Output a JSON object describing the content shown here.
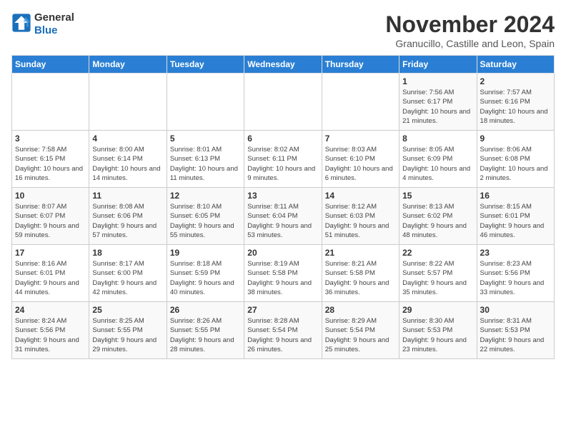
{
  "logo": {
    "general": "General",
    "blue": "Blue"
  },
  "title": "November 2024",
  "location": "Granucillo, Castille and Leon, Spain",
  "days_header": [
    "Sunday",
    "Monday",
    "Tuesday",
    "Wednesday",
    "Thursday",
    "Friday",
    "Saturday"
  ],
  "weeks": [
    [
      {
        "day": "",
        "sunrise": "",
        "sunset": "",
        "daylight": ""
      },
      {
        "day": "",
        "sunrise": "",
        "sunset": "",
        "daylight": ""
      },
      {
        "day": "",
        "sunrise": "",
        "sunset": "",
        "daylight": ""
      },
      {
        "day": "",
        "sunrise": "",
        "sunset": "",
        "daylight": ""
      },
      {
        "day": "",
        "sunrise": "",
        "sunset": "",
        "daylight": ""
      },
      {
        "day": "1",
        "sunrise": "Sunrise: 7:56 AM",
        "sunset": "Sunset: 6:17 PM",
        "daylight": "Daylight: 10 hours and 21 minutes."
      },
      {
        "day": "2",
        "sunrise": "Sunrise: 7:57 AM",
        "sunset": "Sunset: 6:16 PM",
        "daylight": "Daylight: 10 hours and 18 minutes."
      }
    ],
    [
      {
        "day": "3",
        "sunrise": "Sunrise: 7:58 AM",
        "sunset": "Sunset: 6:15 PM",
        "daylight": "Daylight: 10 hours and 16 minutes."
      },
      {
        "day": "4",
        "sunrise": "Sunrise: 8:00 AM",
        "sunset": "Sunset: 6:14 PM",
        "daylight": "Daylight: 10 hours and 14 minutes."
      },
      {
        "day": "5",
        "sunrise": "Sunrise: 8:01 AM",
        "sunset": "Sunset: 6:13 PM",
        "daylight": "Daylight: 10 hours and 11 minutes."
      },
      {
        "day": "6",
        "sunrise": "Sunrise: 8:02 AM",
        "sunset": "Sunset: 6:11 PM",
        "daylight": "Daylight: 10 hours and 9 minutes."
      },
      {
        "day": "7",
        "sunrise": "Sunrise: 8:03 AM",
        "sunset": "Sunset: 6:10 PM",
        "daylight": "Daylight: 10 hours and 6 minutes."
      },
      {
        "day": "8",
        "sunrise": "Sunrise: 8:05 AM",
        "sunset": "Sunset: 6:09 PM",
        "daylight": "Daylight: 10 hours and 4 minutes."
      },
      {
        "day": "9",
        "sunrise": "Sunrise: 8:06 AM",
        "sunset": "Sunset: 6:08 PM",
        "daylight": "Daylight: 10 hours and 2 minutes."
      }
    ],
    [
      {
        "day": "10",
        "sunrise": "Sunrise: 8:07 AM",
        "sunset": "Sunset: 6:07 PM",
        "daylight": "Daylight: 9 hours and 59 minutes."
      },
      {
        "day": "11",
        "sunrise": "Sunrise: 8:08 AM",
        "sunset": "Sunset: 6:06 PM",
        "daylight": "Daylight: 9 hours and 57 minutes."
      },
      {
        "day": "12",
        "sunrise": "Sunrise: 8:10 AM",
        "sunset": "Sunset: 6:05 PM",
        "daylight": "Daylight: 9 hours and 55 minutes."
      },
      {
        "day": "13",
        "sunrise": "Sunrise: 8:11 AM",
        "sunset": "Sunset: 6:04 PM",
        "daylight": "Daylight: 9 hours and 53 minutes."
      },
      {
        "day": "14",
        "sunrise": "Sunrise: 8:12 AM",
        "sunset": "Sunset: 6:03 PM",
        "daylight": "Daylight: 9 hours and 51 minutes."
      },
      {
        "day": "15",
        "sunrise": "Sunrise: 8:13 AM",
        "sunset": "Sunset: 6:02 PM",
        "daylight": "Daylight: 9 hours and 48 minutes."
      },
      {
        "day": "16",
        "sunrise": "Sunrise: 8:15 AM",
        "sunset": "Sunset: 6:01 PM",
        "daylight": "Daylight: 9 hours and 46 minutes."
      }
    ],
    [
      {
        "day": "17",
        "sunrise": "Sunrise: 8:16 AM",
        "sunset": "Sunset: 6:01 PM",
        "daylight": "Daylight: 9 hours and 44 minutes."
      },
      {
        "day": "18",
        "sunrise": "Sunrise: 8:17 AM",
        "sunset": "Sunset: 6:00 PM",
        "daylight": "Daylight: 9 hours and 42 minutes."
      },
      {
        "day": "19",
        "sunrise": "Sunrise: 8:18 AM",
        "sunset": "Sunset: 5:59 PM",
        "daylight": "Daylight: 9 hours and 40 minutes."
      },
      {
        "day": "20",
        "sunrise": "Sunrise: 8:19 AM",
        "sunset": "Sunset: 5:58 PM",
        "daylight": "Daylight: 9 hours and 38 minutes."
      },
      {
        "day": "21",
        "sunrise": "Sunrise: 8:21 AM",
        "sunset": "Sunset: 5:58 PM",
        "daylight": "Daylight: 9 hours and 36 minutes."
      },
      {
        "day": "22",
        "sunrise": "Sunrise: 8:22 AM",
        "sunset": "Sunset: 5:57 PM",
        "daylight": "Daylight: 9 hours and 35 minutes."
      },
      {
        "day": "23",
        "sunrise": "Sunrise: 8:23 AM",
        "sunset": "Sunset: 5:56 PM",
        "daylight": "Daylight: 9 hours and 33 minutes."
      }
    ],
    [
      {
        "day": "24",
        "sunrise": "Sunrise: 8:24 AM",
        "sunset": "Sunset: 5:56 PM",
        "daylight": "Daylight: 9 hours and 31 minutes."
      },
      {
        "day": "25",
        "sunrise": "Sunrise: 8:25 AM",
        "sunset": "Sunset: 5:55 PM",
        "daylight": "Daylight: 9 hours and 29 minutes."
      },
      {
        "day": "26",
        "sunrise": "Sunrise: 8:26 AM",
        "sunset": "Sunset: 5:55 PM",
        "daylight": "Daylight: 9 hours and 28 minutes."
      },
      {
        "day": "27",
        "sunrise": "Sunrise: 8:28 AM",
        "sunset": "Sunset: 5:54 PM",
        "daylight": "Daylight: 9 hours and 26 minutes."
      },
      {
        "day": "28",
        "sunrise": "Sunrise: 8:29 AM",
        "sunset": "Sunset: 5:54 PM",
        "daylight": "Daylight: 9 hours and 25 minutes."
      },
      {
        "day": "29",
        "sunrise": "Sunrise: 8:30 AM",
        "sunset": "Sunset: 5:53 PM",
        "daylight": "Daylight: 9 hours and 23 minutes."
      },
      {
        "day": "30",
        "sunrise": "Sunrise: 8:31 AM",
        "sunset": "Sunset: 5:53 PM",
        "daylight": "Daylight: 9 hours and 22 minutes."
      }
    ]
  ]
}
